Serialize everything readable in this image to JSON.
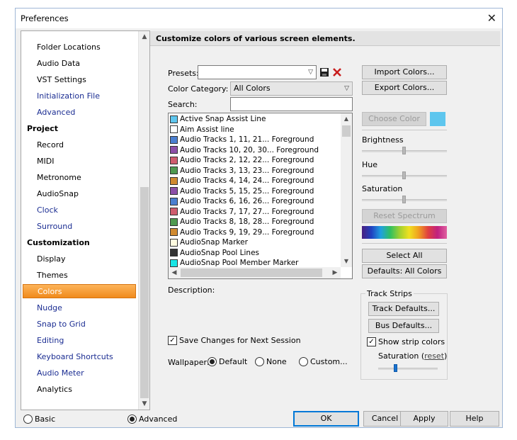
{
  "window": {
    "title": "Preferences"
  },
  "nav": {
    "items": [
      {
        "label": "Folder Locations",
        "kind": "child"
      },
      {
        "label": "Audio Data",
        "kind": "child"
      },
      {
        "label": "VST Settings",
        "kind": "child"
      },
      {
        "label": "Initialization File",
        "kind": "child",
        "blue": true
      },
      {
        "label": "Advanced",
        "kind": "child",
        "blue": true
      },
      {
        "label": "Project",
        "kind": "parent"
      },
      {
        "label": "Record",
        "kind": "child"
      },
      {
        "label": "MIDI",
        "kind": "child"
      },
      {
        "label": "Metronome",
        "kind": "child"
      },
      {
        "label": "AudioSnap",
        "kind": "child"
      },
      {
        "label": "Clock",
        "kind": "child",
        "blue": true
      },
      {
        "label": "Surround",
        "kind": "child",
        "blue": true
      },
      {
        "label": "Customization",
        "kind": "parent"
      },
      {
        "label": "Display",
        "kind": "child"
      },
      {
        "label": "Themes",
        "kind": "child"
      },
      {
        "label": "Colors",
        "kind": "child",
        "selected": true
      },
      {
        "label": "Nudge",
        "kind": "child",
        "blue": true
      },
      {
        "label": "Snap to Grid",
        "kind": "child",
        "blue": true
      },
      {
        "label": "Editing",
        "kind": "child",
        "blue": true
      },
      {
        "label": "Keyboard Shortcuts",
        "kind": "child",
        "blue": true
      },
      {
        "label": "Audio Meter",
        "kind": "child",
        "blue": true
      },
      {
        "label": "Analytics",
        "kind": "child"
      }
    ]
  },
  "panel": {
    "header": "Customize colors of various screen elements.",
    "presets_label": "Presets:",
    "presets_value": "",
    "category_label": "Color Category:",
    "category_value": "All Colors",
    "search_label": "Search:",
    "search_value": "",
    "color_list": [
      {
        "label": "Active Snap Assist Line",
        "color": "#5ec6ee"
      },
      {
        "label": "Aim Assist line",
        "color": "#ffffff"
      },
      {
        "label": "Audio Tracks 1, 11, 21... Foreground",
        "color": "#4a7fd0"
      },
      {
        "label": "Audio Tracks 10, 20, 30... Foreground",
        "color": "#8d4fa8"
      },
      {
        "label": "Audio Tracks 2, 12, 22... Foreground",
        "color": "#cf5c6e"
      },
      {
        "label": "Audio Tracks 3, 13, 23... Foreground",
        "color": "#4f9a50"
      },
      {
        "label": "Audio Tracks 4, 14, 24... Foreground",
        "color": "#d08a30"
      },
      {
        "label": "Audio Tracks 5, 15, 25... Foreground",
        "color": "#8d4fa8"
      },
      {
        "label": "Audio Tracks 6, 16, 26... Foreground",
        "color": "#4a7fd0"
      },
      {
        "label": "Audio Tracks 7, 17, 27... Foreground",
        "color": "#cf5c6e"
      },
      {
        "label": "Audio Tracks 8, 18, 28... Foreground",
        "color": "#4f9a50"
      },
      {
        "label": "Audio Tracks 9, 19, 29... Foreground",
        "color": "#d08a30"
      },
      {
        "label": "AudioSnap Marker",
        "color": "#fffbe0"
      },
      {
        "label": "AudioSnap Pool Lines",
        "color": "#333333"
      },
      {
        "label": "AudioSnap Pool Member Marker",
        "color": "#19e6e6"
      }
    ],
    "description_label": "Description:",
    "save_changes_label": "Save Changes for Next Session",
    "wallpaper_label": "Wallpaper:",
    "wallpaper_options": [
      "Default",
      "None",
      "Custom..."
    ],
    "import_label": "Import Colors...",
    "export_label": "Export Colors...",
    "choose_color_label": "Choose Color",
    "current_color": "#5ec6ee",
    "brightness_label": "Brightness",
    "brightness_value": 0.5,
    "hue_label": "Hue",
    "hue_value": 0.5,
    "saturation_label": "Saturation",
    "saturation_value": 0.5,
    "reset_spectrum_label": "Reset Spectrum",
    "select_all_label": "Select All",
    "defaults_all_label": "Defaults: All Colors",
    "track_strips": {
      "title": "Track Strips",
      "track_defaults_label": "Track Defaults...",
      "bus_defaults_label": "Bus Defaults...",
      "show_strip_colors_label": "Show strip colors",
      "saturation_label": "Saturation (",
      "reset_label": "reset",
      "close_paren": ")",
      "saturation_value": 0.3
    }
  },
  "footer": {
    "basic_label": "Basic",
    "advanced_label": "Advanced",
    "ok_label": "OK",
    "cancel_label": "Cancel",
    "apply_label": "Apply",
    "help_label": "Help"
  }
}
